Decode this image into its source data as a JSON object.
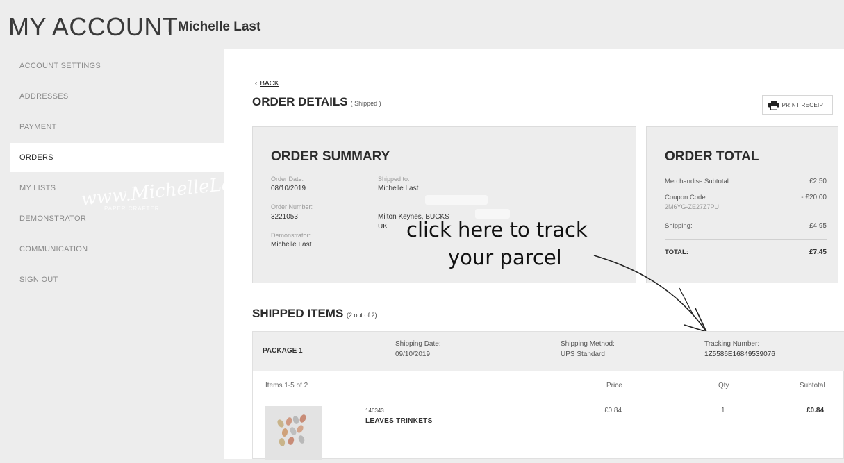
{
  "header": {
    "title": "MY ACCOUNT",
    "user_name": "Michelle Last"
  },
  "sidebar": {
    "items": [
      {
        "label": "ACCOUNT SETTINGS",
        "active": false
      },
      {
        "label": "ADDRESSES",
        "active": false
      },
      {
        "label": "PAYMENT",
        "active": false
      },
      {
        "label": "ORDERS",
        "active": true
      },
      {
        "label": "MY LISTS",
        "active": false
      },
      {
        "label": "DEMONSTRATOR",
        "active": false
      },
      {
        "label": "COMMUNICATION",
        "active": false
      },
      {
        "label": "SIGN OUT",
        "active": false
      }
    ],
    "watermark": "www.MichelleLast.co.uk",
    "watermark_sub": "PAPER CRAFTER"
  },
  "order": {
    "back_label": "BACK",
    "title": "ORDER DETAILS",
    "status": "( Shipped )",
    "print_label": "PRINT RECEIPT"
  },
  "summary": {
    "title": "ORDER SUMMARY",
    "order_date_label": "Order Date:",
    "order_date": "08/10/2019",
    "order_number_label": "Order Number:",
    "order_number": "3221053",
    "demonstrator_label": "Demonstrator:",
    "demonstrator": "Michelle Last",
    "shipped_to_label": "Shipped to:",
    "shipped_to_name": "Michelle Last",
    "shipped_to_city": "Milton Keynes, BUCKS",
    "shipped_to_country": "UK"
  },
  "totals": {
    "title": "ORDER TOTAL",
    "merch_label": "Merchandise Subtotal:",
    "merch_value": "£2.50",
    "coupon_label": "Coupon Code",
    "coupon_code": "2M6YG-ZE27Z7PU",
    "coupon_value": "- £20.00",
    "shipping_label": "Shipping:",
    "shipping_value": "£4.95",
    "total_label": "TOTAL:",
    "total_value": "£7.45"
  },
  "annotation": {
    "line1": "click here to track",
    "line2": "your parcel"
  },
  "shipped": {
    "title": "SHIPPED ITEMS",
    "count": "(2 out of 2)",
    "package_name": "PACKAGE 1",
    "shipping_date_label": "Shipping Date:",
    "shipping_date": "09/10/2019",
    "shipping_method_label": "Shipping Method:",
    "shipping_method": "UPS Standard",
    "tracking_label": "Tracking Number:",
    "tracking_number": "1Z5586E16849539076",
    "items_range": "Items 1-5 of 2",
    "col_price": "Price",
    "col_qty": "Qty",
    "col_subtotal": "Subtotal",
    "items": [
      {
        "sku": "146343",
        "name": "LEAVES TRINKETS",
        "price": "£0.84",
        "qty": "1",
        "subtotal": "£0.84"
      }
    ]
  },
  "colors": {
    "sidebar_bg": "#ededed",
    "panel_bg": "#ededed",
    "main_bg": "#ffffff",
    "text_dark": "#2b2b2b"
  }
}
